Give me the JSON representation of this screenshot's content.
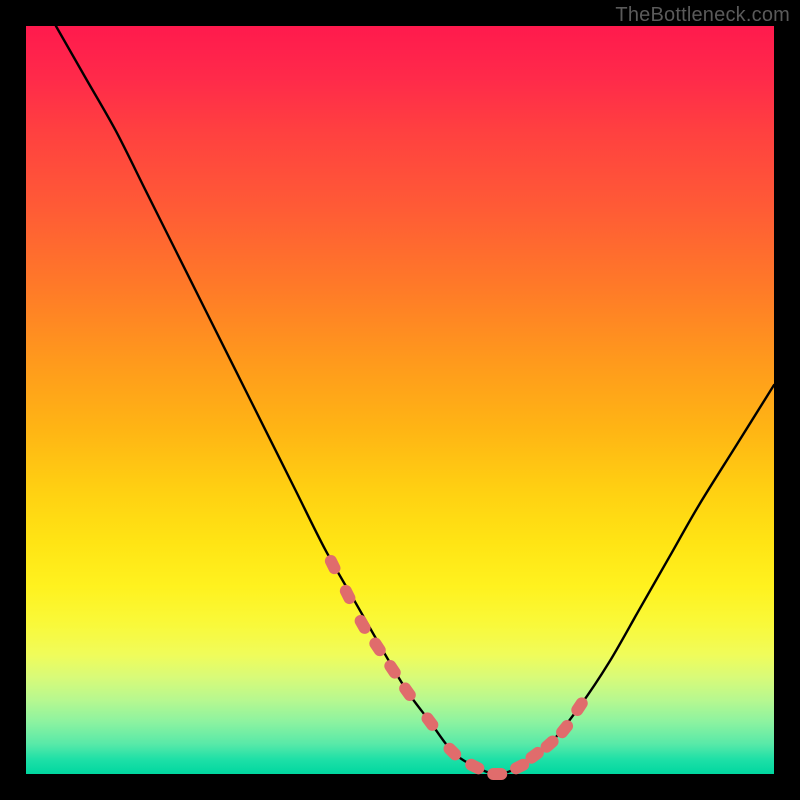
{
  "watermark": "TheBottleneck.com",
  "colors": {
    "background": "#000000",
    "gradient_top": "#ff1a4d",
    "gradient_mid": "#ffe414",
    "gradient_bottom": "#00d7a0",
    "curve": "#000000",
    "marker": "#e06c6c"
  },
  "chart_data": {
    "type": "line",
    "title": "",
    "xlabel": "",
    "ylabel": "",
    "xlim": [
      0,
      100
    ],
    "ylim": [
      0,
      100
    ],
    "grid": false,
    "legend": false,
    "series": [
      {
        "name": "bottleneck-curve",
        "x": [
          4,
          8,
          12,
          16,
          20,
          24,
          28,
          32,
          36,
          40,
          44,
          48,
          51,
          54,
          57,
          60,
          63,
          66,
          70,
          74,
          78,
          82,
          86,
          90,
          95,
          100
        ],
        "y": [
          100,
          93,
          86,
          78,
          70,
          62,
          54,
          46,
          38,
          30,
          23,
          16,
          11,
          7,
          3,
          1,
          0,
          1,
          4,
          9,
          15,
          22,
          29,
          36,
          44,
          52
        ]
      }
    ],
    "markers": {
      "name": "highlight-dots",
      "x": [
        41,
        43,
        45,
        47,
        49,
        51,
        54,
        57,
        60,
        63,
        66,
        68,
        70,
        72,
        74
      ],
      "y": [
        28,
        24,
        20,
        17,
        14,
        11,
        7,
        3,
        1,
        0,
        1,
        2.5,
        4,
        6,
        9
      ]
    }
  }
}
